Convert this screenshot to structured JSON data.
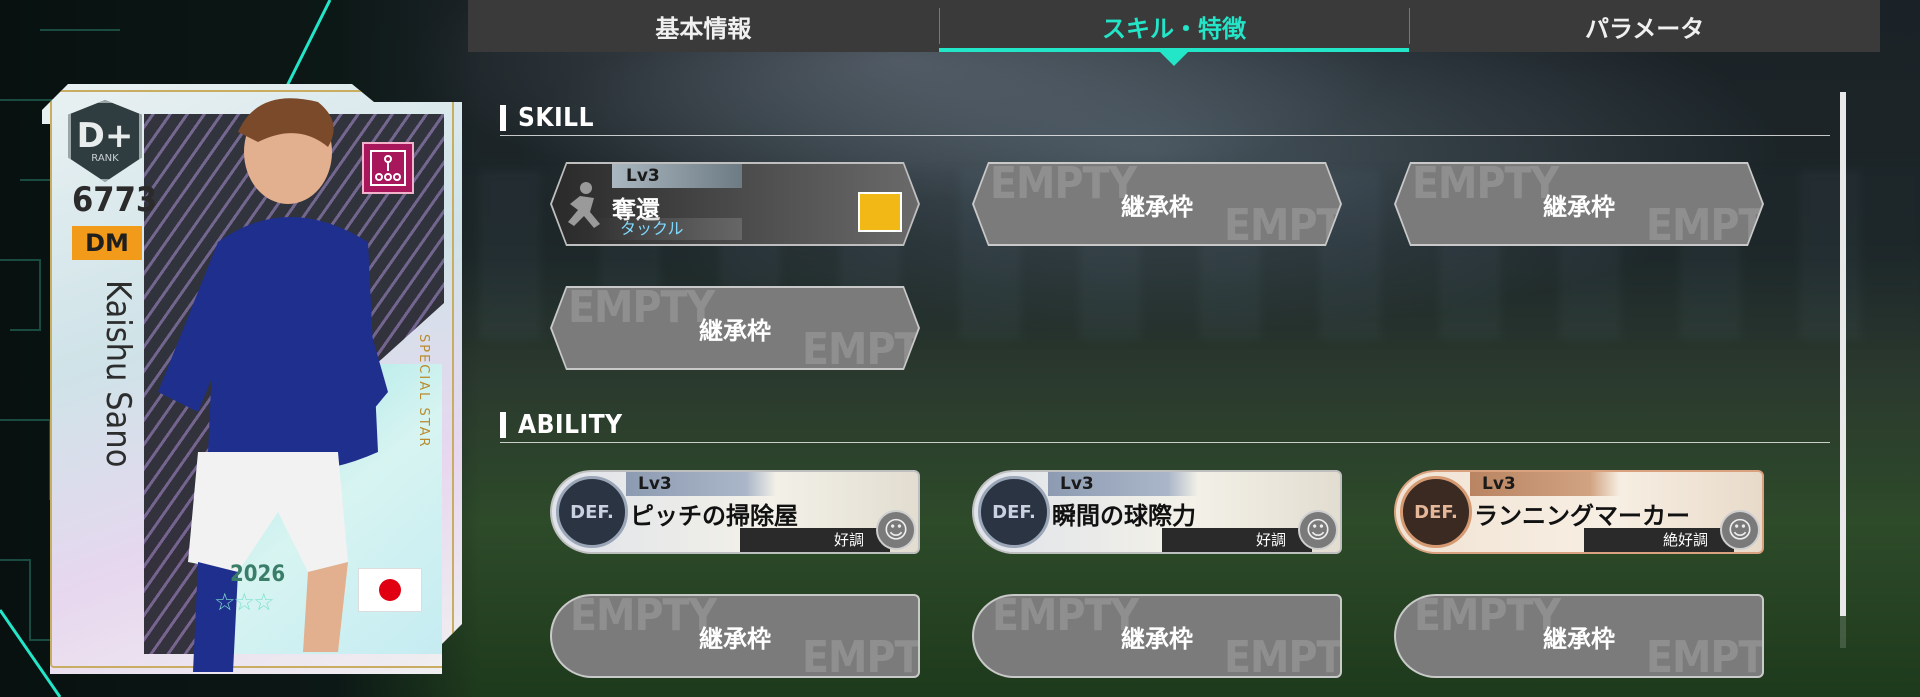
{
  "tabs": [
    {
      "label": "基本情報",
      "active": false
    },
    {
      "label": "スキル・特徴",
      "active": true
    },
    {
      "label": "パラメータ",
      "active": false
    }
  ],
  "accent_color": "#23e5c8",
  "card": {
    "rank": "D+",
    "rank_label": "RANK",
    "rating": "6773",
    "position": "DM",
    "player_name": "Kaishu Sano",
    "special_text": "SPECIAL STAR",
    "year": "2026",
    "stars": "☆☆☆",
    "nationality_flag": "japan-flag-icon"
  },
  "skill": {
    "title": "SKILL",
    "filled": {
      "level": "Lv3",
      "name": "奪還",
      "category": "タックル"
    },
    "empty_label": "継承枠",
    "empty_watermark": "EMPTY"
  },
  "ability": {
    "title": "ABILITY",
    "items": [
      {
        "level": "Lv3",
        "badge": "DEF.",
        "name": "ピッチの掃除屋",
        "condition": "好調",
        "tier": "blue"
      },
      {
        "level": "Lv3",
        "badge": "DEF.",
        "name": "瞬間の球際力",
        "condition": "好調",
        "tier": "blue"
      },
      {
        "level": "Lv3",
        "badge": "DEF.",
        "name": "ランニングマーカー",
        "condition": "絶好調",
        "tier": "bronze"
      }
    ],
    "empty_label": "継承枠",
    "empty_watermark": "EMPTY"
  }
}
